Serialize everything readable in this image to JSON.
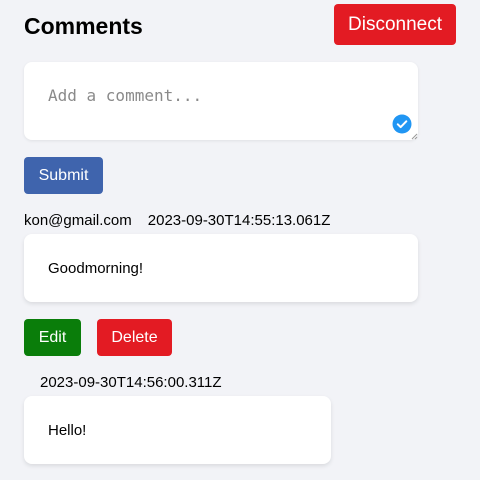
{
  "header": {
    "title": "Comments",
    "disconnect_label": "Disconnect"
  },
  "composer": {
    "placeholder": "Add a comment...",
    "submit_label": "Submit"
  },
  "comments": [
    {
      "author": "kon@gmail.com",
      "timestamp": "2023-09-30T14:55:13.061Z",
      "text": "Goodmorning!",
      "edit_label": "Edit",
      "delete_label": "Delete"
    },
    {
      "author": "",
      "timestamp": "2023-09-30T14:56:00.311Z",
      "text": "Hello!"
    }
  ],
  "colors": {
    "disconnect": "#e31b23",
    "submit": "#3f64ad",
    "edit": "#0a7d0a",
    "delete": "#e31b23",
    "background": "#f2f3f7"
  }
}
